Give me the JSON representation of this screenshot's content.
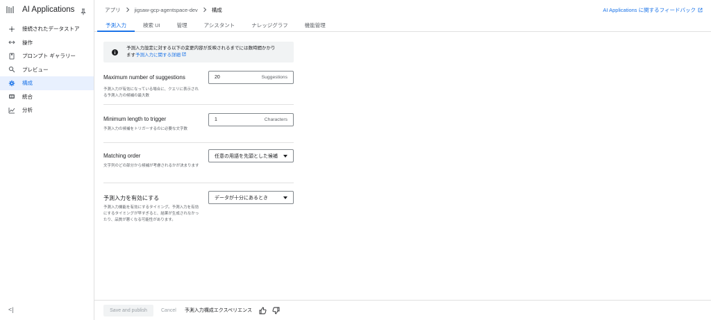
{
  "app": {
    "title": "AI Applications"
  },
  "sidebar": {
    "items": [
      {
        "label": "接続されたデータストア",
        "icon": "connect-icon"
      },
      {
        "label": "操作",
        "icon": "arrows-icon"
      },
      {
        "label": "プロンプト ギャラリー",
        "icon": "gallery-icon"
      },
      {
        "label": "プレビュー",
        "icon": "search-icon"
      },
      {
        "label": "構成",
        "icon": "gear-icon"
      },
      {
        "label": "統合",
        "icon": "integration-icon"
      },
      {
        "label": "分析",
        "icon": "chart-icon"
      }
    ],
    "active_index": 4,
    "collapse_glyph": "<|"
  },
  "breadcrumb": {
    "items": [
      "アプリ",
      "jigsaw-gcp-agentspace-dev",
      "構成"
    ]
  },
  "header": {
    "feedback": "AI Applications に関するフィードバック"
  },
  "tabs": [
    "予測入力",
    "検索 UI",
    "管理",
    "アシスタント",
    "ナレッジグラフ",
    "機能管理"
  ],
  "banner": {
    "text_line1": "予測入力設定に対する以下の変更内容が反映されるまでには数時間かかり",
    "text_prefix": "ます",
    "link": "予測入力に関する詳細"
  },
  "settings": [
    {
      "title": "Maximum number of suggestions",
      "description": "予測入力が有効になっている場合に、クエリに表示される予測入力の候補の最大数",
      "value": "20",
      "suffix": "Suggestions"
    },
    {
      "title": "Minimum length to trigger",
      "description": "予測入力の候補をトリガーするのに必要な文字数",
      "value": "1",
      "suffix": "Characters"
    },
    {
      "title": "Matching order",
      "description": "文字列のどの部分から候補が考慮されるかが決まります",
      "value": "任意の用語を先頭とした候補"
    },
    {
      "title": "予測入力を有効にする",
      "description": "予測入力機能を有効にするタイミング。予測入力を有効にするタイミングが早すぎると、結果が生成されなかったり、品質が悪くなる可能性があります。",
      "value": "データが十分にあるとき"
    }
  ],
  "footer": {
    "save": "Save and publish",
    "cancel": "Cancel",
    "experience_label": "予測入力構成エクスペリエンス"
  },
  "colors": {
    "accent": "#1a73e8",
    "active_bg": "#e8f0fe",
    "banner_bg": "#f1f3f4"
  }
}
